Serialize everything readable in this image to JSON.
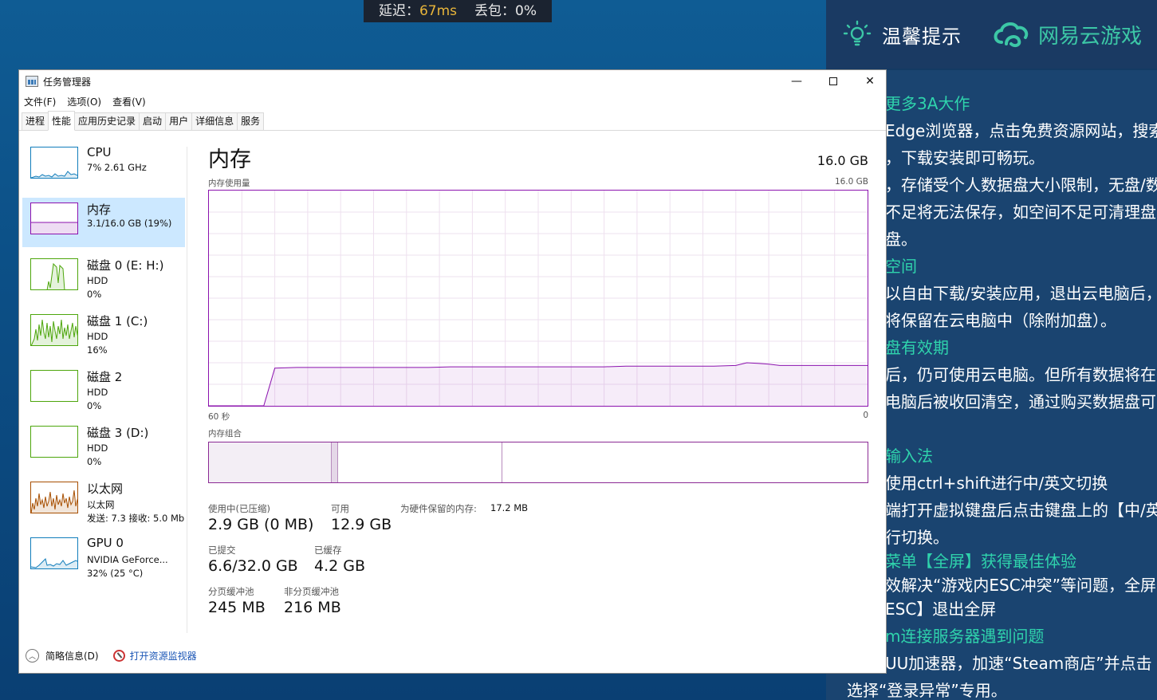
{
  "overlay": {
    "latency_label": "延迟：",
    "latency_value": "67ms",
    "loss_label": "丢包：",
    "loss_value": "0%"
  },
  "tips": {
    "header_title": "温馨提示",
    "brand": "网易云游戏",
    "lines": [
      {
        "text": "更多3A大作",
        "hl": true
      },
      {
        "text": "Edge浏览器，点击免费资源网站，搜索",
        "hl": false
      },
      {
        "text": "，下载安装即可畅玩。",
        "hl": false
      },
      {
        "text": "，存储受个人数据盘大小限制，无盘/数",
        "hl": false
      },
      {
        "text": "不足将无法保存，如空间不足可清理盘",
        "hl": false
      },
      {
        "text": "盘。",
        "hl": false
      },
      {
        "text": "空间",
        "hl": true
      },
      {
        "text": "以自由下载/安装应用，退出云电脑后，",
        "hl": false
      },
      {
        "text": "将保留在云电脑中（除附加盘）。",
        "hl": false
      },
      {
        "text": "盘有效期",
        "hl": true
      },
      {
        "text": "后，仍可使用云电脑。但所有数据将在",
        "hl": false
      },
      {
        "text": "电脑后被收回清空，通过购买数据盘可",
        "hl": false
      },
      {
        "text": "输入法",
        "hl": true
      },
      {
        "text": "使用ctrl+shift进行中/英文切换",
        "hl": false
      },
      {
        "text": "端打开虚拟键盘后点击键盘上的【中/英",
        "hl": false
      },
      {
        "text": "行切换。",
        "hl": false
      },
      {
        "text": "菜单【全屏】获得最佳体验",
        "hl": true
      },
      {
        "text": "效解决“游戏内ESC冲突”等问题，全屏",
        "hl": false
      },
      {
        "text": "ESC】退出全屏",
        "hl": false
      },
      {
        "text": "m连接服务器遇到问题",
        "hl": true
      },
      {
        "text": "UU加速器，加速“Steam商店”并点击",
        "hl": false
      },
      {
        "text": "选择“登录异常”专用。",
        "hl": false
      }
    ]
  },
  "window": {
    "title": "任务管理器",
    "minimize": "—",
    "close": "✕"
  },
  "menu": [
    "文件(F)",
    "选项(O)",
    "查看(V)"
  ],
  "tabs": [
    {
      "label": "进程",
      "active": false
    },
    {
      "label": "性能",
      "active": true
    },
    {
      "label": "应用历史记录",
      "active": false
    },
    {
      "label": "启动",
      "active": false
    },
    {
      "label": "用户",
      "active": false
    },
    {
      "label": "详细信息",
      "active": false
    },
    {
      "label": "服务",
      "active": false
    }
  ],
  "sidebar": [
    {
      "name": "CPU",
      "l2": "7%  2.61 GHz",
      "l3": "",
      "color": "#117dbb",
      "active": false
    },
    {
      "name": "内存",
      "l2": "3.1/16.0 GB (19%)",
      "l3": "",
      "color": "#8b12ae",
      "active": true
    },
    {
      "name": "磁盘 0 (E: H:)",
      "l2": "HDD",
      "l3": "0%",
      "color": "#4da60c",
      "active": false
    },
    {
      "name": "磁盘 1 (C:)",
      "l2": "HDD",
      "l3": "16%",
      "color": "#4da60c",
      "active": false
    },
    {
      "name": "磁盘 2",
      "l2": "HDD",
      "l3": "0%",
      "color": "#4da60c",
      "active": false
    },
    {
      "name": "磁盘 3 (D:)",
      "l2": "HDD",
      "l3": "0%",
      "color": "#4da60c",
      "active": false
    },
    {
      "name": "以太网",
      "l2": "以太网",
      "l3": "发送: 7.3  接收: 5.0 Mb",
      "color": "#a74f01",
      "active": false
    },
    {
      "name": "GPU 0",
      "l2": "NVIDIA GeForce...",
      "l3": "32% (25 °C)",
      "color": "#117dbb",
      "active": false
    }
  ],
  "main": {
    "title": "内存",
    "total": "16.0 GB",
    "usage_label": "内存使用量",
    "usage_max": "16.0 GB",
    "x_left": "60 秒",
    "x_right": "0",
    "composition_label": "内存组合",
    "stats": {
      "in_use_label": "使用中(已压缩)",
      "in_use_value": "2.9 GB (0 MB)",
      "available_label": "可用",
      "available_value": "12.9 GB",
      "reserved_label": "为硬件保留的内存:",
      "reserved_value": "17.2 MB",
      "committed_label": "已提交",
      "committed_value": "6.6/32.0 GB",
      "cached_label": "已缓存",
      "cached_value": "4.2 GB",
      "paged_label": "分页缓冲池",
      "paged_value": "245 MB",
      "nonpaged_label": "非分页缓冲池",
      "nonpaged_value": "216 MB"
    }
  },
  "footer": {
    "brief": "简略信息(D)",
    "resmon": "打开资源监视器"
  },
  "chart_data": {
    "type": "area",
    "title": "内存使用量",
    "xlabel": "",
    "ylabel": "",
    "x_range": [
      60,
      0
    ],
    "ylim": [
      0,
      16.0
    ],
    "color": "#8b12ae",
    "series": [
      {
        "name": "",
        "x": [
          60,
          59,
          58,
          57,
          56,
          55,
          54,
          52,
          50,
          48,
          46,
          44,
          42,
          40,
          38,
          36,
          34,
          32,
          30,
          28,
          26,
          24,
          22,
          20,
          18,
          16,
          14,
          12,
          11,
          10,
          9,
          8,
          6,
          4,
          2,
          0
        ],
        "y": [
          0,
          0,
          0,
          0,
          0,
          0,
          2.8,
          2.85,
          2.85,
          2.85,
          2.85,
          2.85,
          2.85,
          2.85,
          2.9,
          2.9,
          2.9,
          2.9,
          2.9,
          2.9,
          2.9,
          2.9,
          2.95,
          2.95,
          2.95,
          2.95,
          2.95,
          3.0,
          3.2,
          3.15,
          3.1,
          3.0,
          3.0,
          3.0,
          3.0,
          3.0
        ]
      }
    ]
  }
}
